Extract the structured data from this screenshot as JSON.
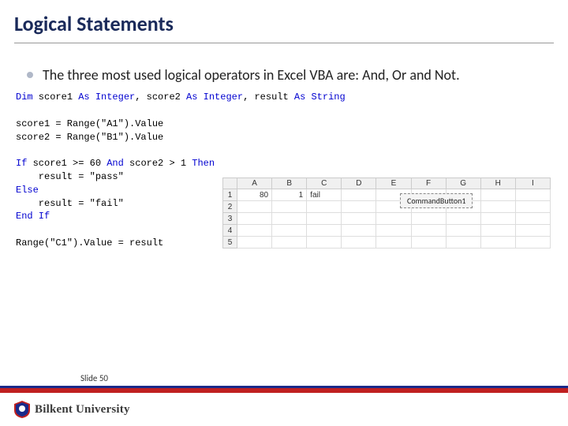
{
  "title": "Logical Statements",
  "bullet": "The three most used logical operators in Excel VBA are: And, Or and Not.",
  "code": {
    "l1a": "Dim",
    "l1b": " score1 ",
    "l1c": "As Integer",
    "l1d": ", score2 ",
    "l1e": "As Integer",
    "l1f": ", result ",
    "l1g": "As String",
    "l2": "score1 = Range(\"A1\").Value",
    "l3": "score2 = Range(\"B1\").Value",
    "l4a": "If",
    "l4b": " score1 >= 60 ",
    "l4c": "And",
    "l4d": " score2 > 1 ",
    "l4e": "Then",
    "l5": "    result = \"pass\"",
    "l6": "Else",
    "l7": "    result = \"fail\"",
    "l8": "End If",
    "l9": "Range(\"C1\").Value = result"
  },
  "excel": {
    "cols": [
      "",
      "A",
      "B",
      "C",
      "D",
      "E",
      "F",
      "G",
      "H",
      "I"
    ],
    "rows": [
      "1",
      "2",
      "3",
      "4",
      "5"
    ],
    "a1": "80",
    "b1": "1",
    "c1": "fail",
    "button": "CommandButton1"
  },
  "footer": {
    "slide": "Slide 50",
    "uni": "Bilkent University"
  }
}
